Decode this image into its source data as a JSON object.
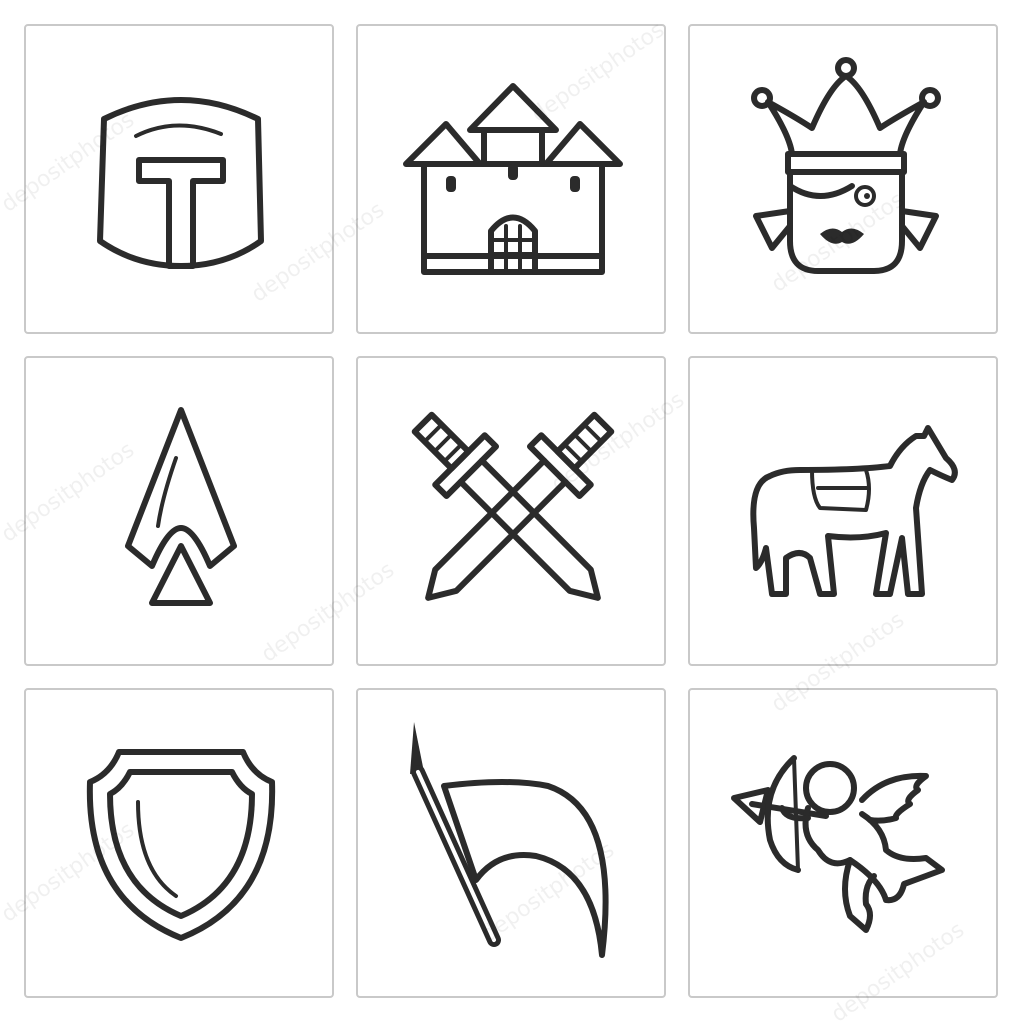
{
  "icons": [
    {
      "name": "knight-helmet-icon"
    },
    {
      "name": "castle-icon"
    },
    {
      "name": "jester-queen-icon"
    },
    {
      "name": "spearhead-icon"
    },
    {
      "name": "crossed-swords-icon"
    },
    {
      "name": "horse-icon"
    },
    {
      "name": "shield-icon"
    },
    {
      "name": "banner-flag-icon"
    },
    {
      "name": "cupid-icon"
    }
  ],
  "watermark": "depositphotos",
  "colors": {
    "ink": "#2b2b2b",
    "border": "#c9c9c9",
    "background": "#ffffff"
  }
}
